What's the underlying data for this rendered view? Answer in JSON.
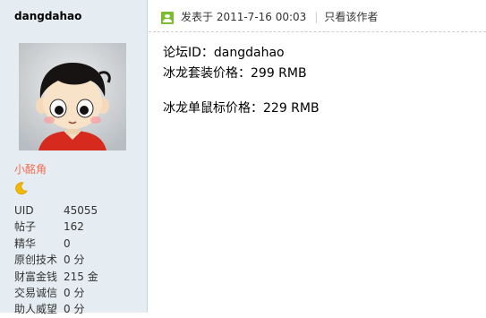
{
  "author": {
    "username": "dangdahao",
    "rank": "小酩角",
    "stats": [
      {
        "label": "UID",
        "value": "45055"
      },
      {
        "label": "帖子",
        "value": "162"
      },
      {
        "label": "精华",
        "value": "0"
      },
      {
        "label": "原创技术",
        "value": "0 分"
      },
      {
        "label": "财富金钱",
        "value": "215 金"
      },
      {
        "label": "交易诚信",
        "value": "0 分"
      },
      {
        "label": "助人威望",
        "value": "0 分"
      }
    ]
  },
  "post": {
    "posted_at": "发表于 2011-7-16 00:03",
    "separator": "|",
    "author_only": "只看该作者",
    "lines": [
      "论坛ID：dangdahao",
      "冰龙套装价格：299 RMB",
      "冰龙单鼠标价格：229 RMB"
    ]
  },
  "colors": {
    "sidebar_bg": "#e5edf2",
    "rank_color": "#f26c4f",
    "online_icon": "#7cbd2f",
    "moon_icon": "#f5b800"
  },
  "icons": {
    "online": "online-user-icon",
    "level": "moon-icon"
  }
}
